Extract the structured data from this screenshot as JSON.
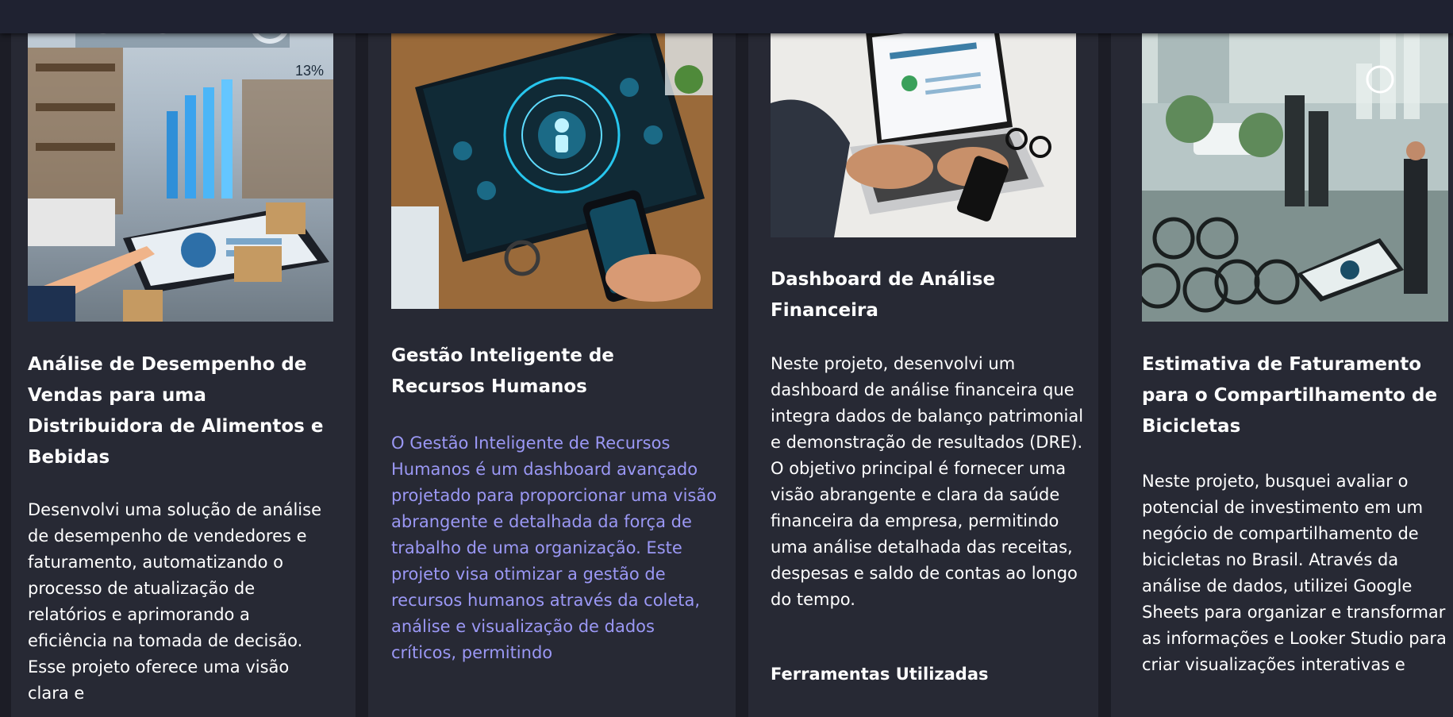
{
  "projects": [
    {
      "title": "Análise de Desempenho de Vendas para uma Distribuidora de Alimentos e Bebidas",
      "description": "Desenvolvi uma solução de análise de desempenho de vendedores e faturamento, automatizando o processo de atualização de relatórios e aprimorando a eficiência na tomada de decisão. Esse projeto oferece uma visão clara e"
    },
    {
      "title": "Gestão Inteligente de Recursos Humanos",
      "description": "O Gestão Inteligente de Recursos Humanos é um dashboard avançado projetado para proporcionar uma visão abrangente e detalhada da força de trabalho de uma organização. Este projeto visa otimizar a gestão de recursos humanos através da coleta, análise e visualização de dados críticos, permitindo"
    },
    {
      "title": "Dashboard de Análise Financeira",
      "description": "Neste projeto, desenvolvi um dashboard de análise financeira que integra dados de balanço patrimonial e demonstração de resultados (DRE). O objetivo principal é fornecer uma visão abrangente e clara da saúde financeira da empresa, permitindo uma análise detalhada das receitas, despesas e saldo de contas ao longo do tempo.",
      "tools_heading": "Ferramentas Utilizadas"
    },
    {
      "title": "Estimativa de Faturamento para o Compartilhamento de Bicicletas",
      "description": "Neste projeto, busquei avaliar o potencial de investimento em um negócio de compartilhamento de bicicletas no Brasil. Através da análise de dados, utilizei Google Sheets para organizar e transformar as informações e Looker Studio para criar visualizações interativas e"
    }
  ],
  "colors": {
    "page_bg": "#1c1d26",
    "card_bg": "#272934",
    "topbar_bg": "#1f2231",
    "accent_text": "#9b98f5"
  }
}
